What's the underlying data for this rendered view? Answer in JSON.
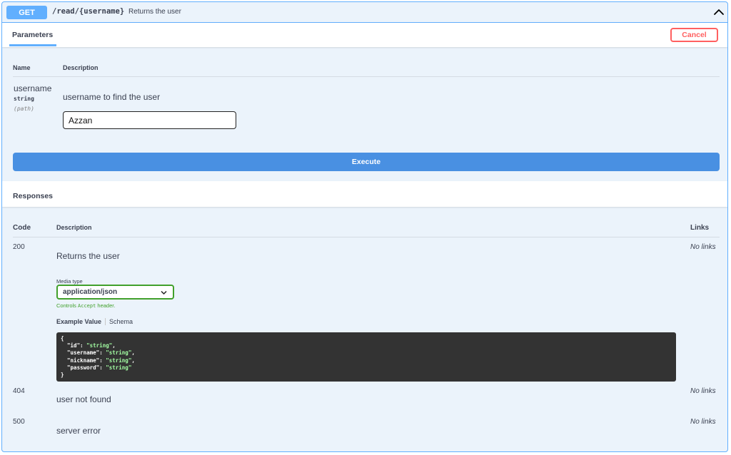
{
  "operation": {
    "method": "GET",
    "path": "/read/{username}",
    "summary": "Returns the user"
  },
  "parameters_section": {
    "tab_label": "Parameters",
    "cancel_label": "Cancel",
    "col_name": "Name",
    "col_description": "Description",
    "param": {
      "name": "username",
      "type": "string",
      "in": "(path)",
      "description": "username to find the user",
      "value": "Azzan"
    },
    "execute_label": "Execute"
  },
  "responses_section": {
    "title": "Responses",
    "col_code": "Code",
    "col_description": "Description",
    "col_links": "Links",
    "items": [
      {
        "code": "200",
        "description": "Returns the user",
        "links": "No links"
      },
      {
        "code": "404",
        "description": "user not found",
        "links": "No links"
      },
      {
        "code": "500",
        "description": "server error",
        "links": "No links"
      }
    ],
    "media_type_label": "Media type",
    "media_type_value": "application/json",
    "controls_prefix": "Controls",
    "controls_code": "Accept",
    "controls_suffix": "header.",
    "example_value_tab": "Example Value",
    "schema_tab": "Schema",
    "example": {
      "open": "{",
      "close": "}",
      "fields": [
        {
          "key": "\"id\"",
          "value": "\"string\"",
          "trail": ","
        },
        {
          "key": "\"username\"",
          "value": "\"string\"",
          "trail": ","
        },
        {
          "key": "\"nickname\"",
          "value": "\"string\"",
          "trail": ","
        },
        {
          "key": "\"password\"",
          "value": "\"string\"",
          "trail": ""
        }
      ]
    }
  },
  "colors": {
    "get_blue": "#61affe",
    "execute_blue": "#4990e2",
    "cancel_red": "#ff6060",
    "success_green": "#41a02b",
    "block_bg": "#ebf3fb"
  },
  "icons": {
    "collapse": "chevron-up-icon",
    "select": "chevron-down-icon"
  }
}
